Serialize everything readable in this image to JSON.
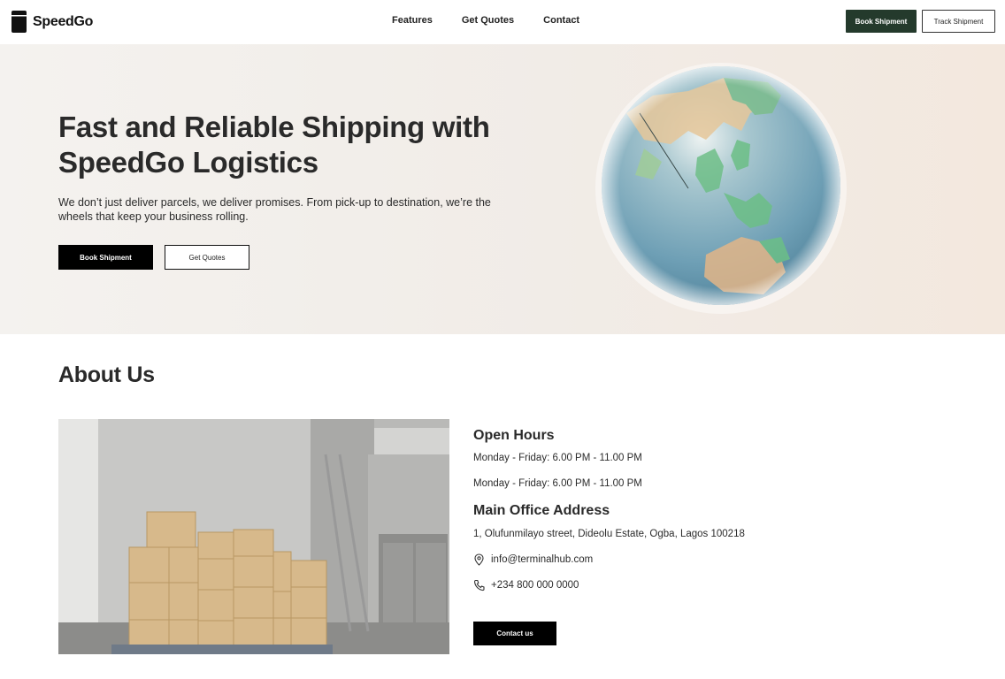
{
  "brand": {
    "name": "SpeedGo"
  },
  "nav": {
    "links": [
      "Features",
      "Get Quotes",
      "Contact"
    ],
    "book_label": "Book Shipment",
    "track_label": "Track Shipment"
  },
  "hero": {
    "title": "Fast and Reliable Shipping with SpeedGo Logistics",
    "subtitle": "We don’t just deliver parcels, we deliver promises. From pick-up to destination, we’re the wheels that keep your business rolling.",
    "book_label": "Book Shipment",
    "quote_label": "Get Quotes"
  },
  "about": {
    "title": "About Us",
    "open_hours_title": "Open Hours",
    "hours": [
      "Monday - Friday: 6.00 PM - 11.00 PM",
      "Monday - Friday: 6.00 PM - 11.00 PM"
    ],
    "address_title": "Main Office Address",
    "address": "1, Olufunmilayo street, Dideolu Estate, Ogba, Lagos 100218",
    "email": "info@terminalhub.com",
    "phone": "+234 800 000 0000",
    "contact_label": "Contact us"
  },
  "colors": {
    "accent": "#243a2c",
    "primary_button": "#000000"
  },
  "icons": {
    "email": "location-pin-icon",
    "phone": "phone-icon"
  }
}
